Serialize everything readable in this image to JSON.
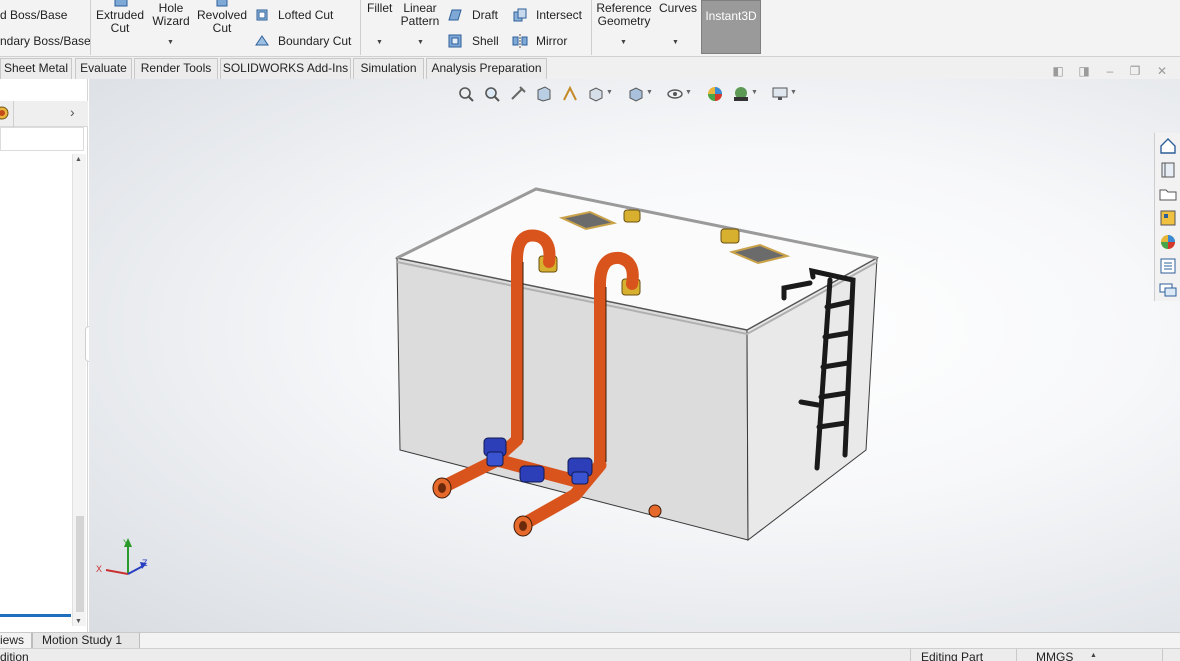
{
  "ribbon": {
    "extruded_boss": "d Boss/Base",
    "boundary_boss": "ndary Boss/Base",
    "extruded_cut_1": "Extruded",
    "extruded_cut_2": "Cut",
    "hole_wizard_1": "Hole",
    "hole_wizard_2": "Wizard",
    "revolved_cut_1": "Revolved",
    "revolved_cut_2": "Cut",
    "lofted_cut": "Lofted Cut",
    "boundary_cut": "Boundary Cut",
    "fillet": "Fillet",
    "linear_pattern_1": "Linear",
    "linear_pattern_2": "Pattern",
    "draft": "Draft",
    "shell": "Shell",
    "intersect": "Intersect",
    "mirror": "Mirror",
    "reference_geometry_1": "Reference",
    "reference_geometry_2": "Geometry",
    "curves": "Curves",
    "instant3d": "Instant3D"
  },
  "tabs": [
    {
      "label": "Sheet Metal"
    },
    {
      "label": "Evaluate"
    },
    {
      "label": "Render Tools"
    },
    {
      "label": "SOLIDWORKS Add-Ins"
    },
    {
      "label": "Simulation"
    },
    {
      "label": "Analysis Preparation"
    }
  ],
  "triad": {
    "x": "X",
    "y": "Y",
    "z": "Z"
  },
  "bottom_tabs": {
    "views": "iews",
    "motion_study": "Motion Study 1"
  },
  "status": {
    "left": "dition",
    "editing": "Editing Part",
    "units": "MMGS"
  },
  "colors": {
    "pipe": "#d9541c",
    "valve": "#2c3fb8",
    "fitting": "#d8b030",
    "tank_front": "#dcdcdc",
    "tank_top": "#fbfbfb"
  }
}
